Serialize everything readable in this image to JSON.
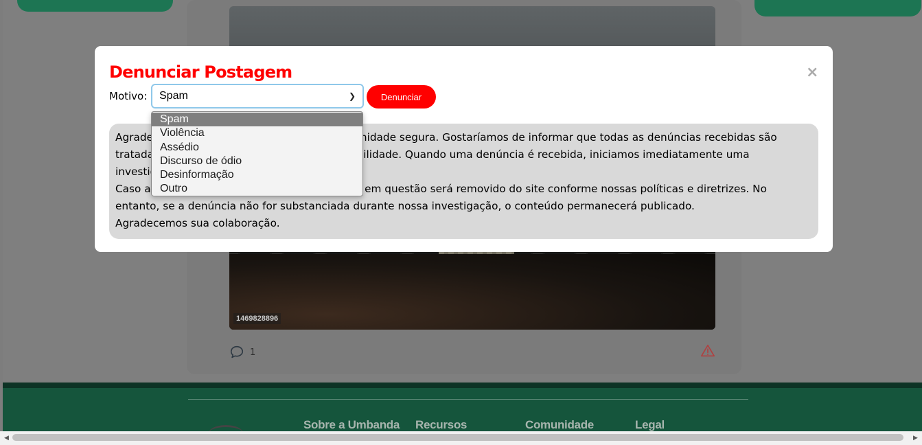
{
  "background_page": {
    "photo_id": "1469828896",
    "comment_count": "1",
    "footer_links": [
      "Sobre a Umbanda",
      "Recursos",
      "Comunidade",
      "Legal"
    ]
  },
  "modal": {
    "title": "Denunciar Postagem",
    "close_label": "×",
    "reason_label": "Motivo:",
    "selected_reason": "Spam",
    "submit_label": "Denunciar",
    "reason_options": [
      "Spam",
      "Violência",
      "Assédio",
      "Discurso de ódio",
      "Desinformação",
      "Outro"
    ],
    "info_lines": [
      "Agradecemos por nos ajudar a manter a comunidade segura. Gostaríamos de informar que todas as denúncias recebidas são tratadas com a máxima seriedade e responsabilidade. Quando uma denúncia é recebida, iniciamos imediatamente uma investigação para verificar sua veracidade.",
      "Caso a denúncia seja comprovada, o conteúdo em questão será removido do site conforme nossas políticas e diretrizes. No entanto, se a denúncia não for substanciada durante nossa investigação, o conteúdo permanecerá publicado.",
      "Agradecemos sua colaboração."
    ]
  },
  "colors": {
    "brand_green": "#1d7553",
    "danger_red": "#ff0000",
    "overlay": "#7f7f7f"
  },
  "icons": [
    "comment-icon",
    "warning-icon",
    "close-icon",
    "chevron-down-icon"
  ]
}
